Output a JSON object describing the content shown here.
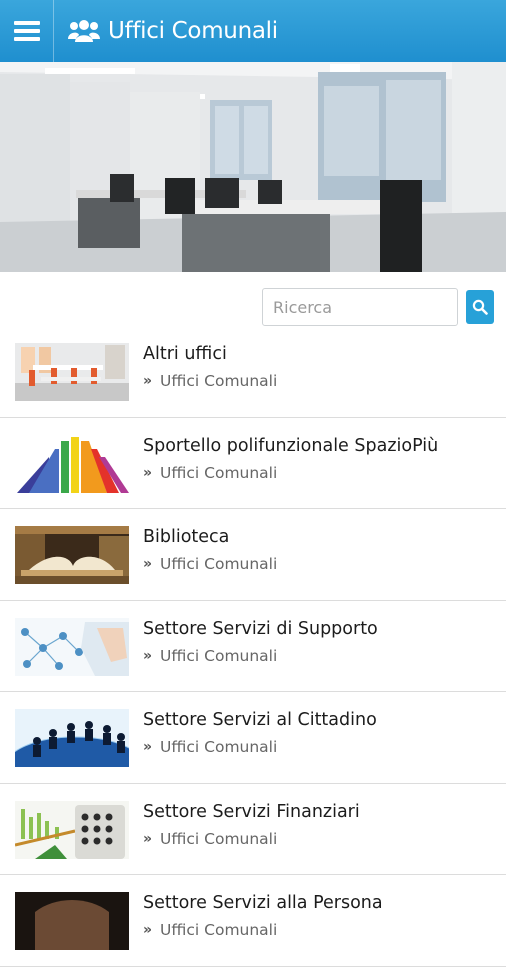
{
  "appbar": {
    "title": "Uffici Comunali",
    "menu_icon": "hamburger-icon",
    "title_icon": "users-group-icon",
    "color": "#2196d3"
  },
  "search": {
    "placeholder": "Ricerca",
    "button_icon": "search-icon",
    "button_color": "#27a1d8"
  },
  "items": [
    {
      "title": "Altri uffici",
      "category": "Uffici Comunali",
      "thumb": "office-room"
    },
    {
      "title": "Sportello polifunzionale SpazioPiù",
      "category": "Uffici Comunali",
      "thumb": "rainbow-steps"
    },
    {
      "title": "Biblioteca",
      "category": "Uffici Comunali",
      "thumb": "books"
    },
    {
      "title": "Settore Servizi di Supporto",
      "category": "Uffici Comunali",
      "thumb": "network-hand"
    },
    {
      "title": "Settore Servizi al Cittadino",
      "category": "Uffici Comunali",
      "thumb": "people-globe"
    },
    {
      "title": "Settore Servizi Finanziari",
      "category": "Uffici Comunali",
      "thumb": "calculator-charts"
    },
    {
      "title": "Settore Servizi alla Persona",
      "category": "Uffici Comunali",
      "thumb": "hands"
    }
  ]
}
